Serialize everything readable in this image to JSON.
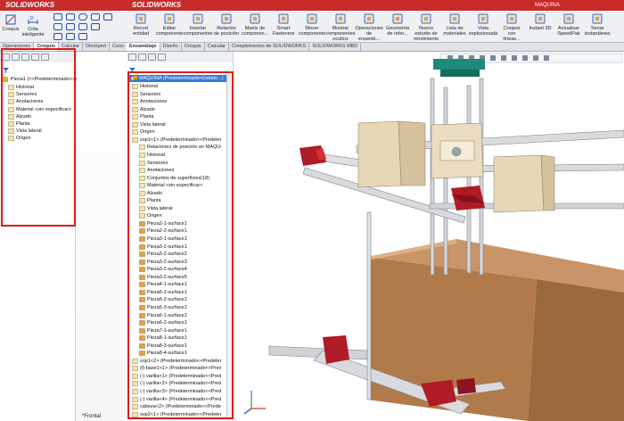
{
  "left_window": {
    "title": "SOLIDWORKS",
    "ribbon_buttons": [
      "Croquis",
      "Cota inteligente"
    ],
    "tabs": [
      "Operaciones",
      "Croquis",
      "Calcular",
      "DimXpert",
      "Cono"
    ],
    "active_tab": "Croquis",
    "part_tree": {
      "root": "Pieza1 (<<Predeterminado>>)",
      "items": [
        "Historial",
        "Sensores",
        "Anotaciones",
        "Material <sin especificar>",
        "Alzado",
        "Planta",
        "Vista lateral",
        "Origen"
      ]
    },
    "status": "*Frontal"
  },
  "right_window": {
    "title": "SOLIDWORKS",
    "document_title": "MAQUINA",
    "ribbon_buttons": [
      "Recort entidad",
      "Editar componente",
      "Insertar componentes",
      "Relación de posición",
      "Matriz de componen...",
      "Smart Fasteners",
      "Mover componente",
      "Mostrar componentes ocultos",
      "Operaciones de ensamb...",
      "Geometría de refer...",
      "Nuevo estudio de movimiento",
      "Lista de materiales",
      "Vista explosionada",
      "Croquis con líneas...",
      "Instant 3D",
      "Actualizar SpeedPak",
      "Tomar instantánea"
    ],
    "tabs": [
      "Ensamblaje",
      "Diseño",
      "Croquis",
      "Calcular",
      "Complementos de SOLIDWORKS",
      "SOLIDWORKS MBD"
    ],
    "active_tab": "Ensamblaje",
    "tree": {
      "root": "MAQUINA (Predeterminado<Estado...)",
      "items": [
        {
          "label": "Historial",
          "level": 1
        },
        {
          "label": "Sensores",
          "level": 1
        },
        {
          "label": "Anotaciones",
          "level": 1
        },
        {
          "label": "Alzado",
          "level": 1
        },
        {
          "label": "Planta",
          "level": 1
        },
        {
          "label": "Vista lateral",
          "level": 1
        },
        {
          "label": "Origen",
          "level": 1
        },
        {
          "label": "sop1<1> (Predeterminado<<Predeter...",
          "level": 1
        },
        {
          "label": "Relaciones de posición en MAQUI...",
          "level": 2
        },
        {
          "label": "Historial",
          "level": 2
        },
        {
          "label": "Sensores",
          "level": 2
        },
        {
          "label": "Anotaciones",
          "level": 2
        },
        {
          "label": "Conjuntos de superficies(18)",
          "level": 2
        },
        {
          "label": "Material <sin especificar>",
          "level": 2
        },
        {
          "label": "Alzado",
          "level": 2
        },
        {
          "label": "Planta",
          "level": 2
        },
        {
          "label": "Vista lateral",
          "level": 2
        },
        {
          "label": "Origen",
          "level": 2
        },
        {
          "label": "Pieza2-1-surface1",
          "level": 2
        },
        {
          "label": "Pieza2-2-surface1",
          "level": 2
        },
        {
          "label": "Pieza3-1-surface1",
          "level": 2
        },
        {
          "label": "Pieza3-2-surface1",
          "level": 2
        },
        {
          "label": "Pieza3-2-surface2",
          "level": 2
        },
        {
          "label": "Pieza3-2-surface3",
          "level": 2
        },
        {
          "label": "Pieza3-2-surface4",
          "level": 2
        },
        {
          "label": "Pieza3-2-surface5",
          "level": 2
        },
        {
          "label": "Pieza4-1-surface1",
          "level": 2
        },
        {
          "label": "Pieza5-1-surface1",
          "level": 2
        },
        {
          "label": "Pieza5-2-surface1",
          "level": 2
        },
        {
          "label": "Pieza5-3-surface1",
          "level": 2
        },
        {
          "label": "Pieza6-1-surface1",
          "level": 2
        },
        {
          "label": "Pieza6-2-surface1",
          "level": 2
        },
        {
          "label": "Pieza7-1-surface1",
          "level": 2
        },
        {
          "label": "Pieza8-1-surface1",
          "level": 2
        },
        {
          "label": "Pieza8-3-surface1",
          "level": 2
        },
        {
          "label": "Pieza8-4-surface1",
          "level": 2
        },
        {
          "label": "sop1<2> (Predeterminado<<Predeter...",
          "level": 1
        },
        {
          "label": "(f) base1<1> (Predeterminado<<Prede...",
          "level": 1
        },
        {
          "label": "(-) varilla<1> (Predeterminado<<Pred...",
          "level": 1
        },
        {
          "label": "(-) varilla<2> (Predeterminado<<Pred...",
          "level": 1
        },
        {
          "label": "(-) varilla<3> (Predeterminado<<Pred...",
          "level": 1
        },
        {
          "label": "(-) varilla<4> (Predeterminado<<Pred...",
          "level": 1
        },
        {
          "label": "cabeza<2> (Predeterminado<<Predet...",
          "level": 1
        },
        {
          "label": "sop2<1> (Predeterminado<<Predeter...",
          "level": 1
        }
      ]
    }
  },
  "colors": {
    "title_bar": "#c92a2a",
    "highlight_border": "#e01818",
    "selected_row": "#3a78d8",
    "box_wood": "#b07a4a",
    "frame_red": "#b01b25",
    "rail_grey": "#c9ccd0",
    "teal_top": "#1d8a7a"
  }
}
